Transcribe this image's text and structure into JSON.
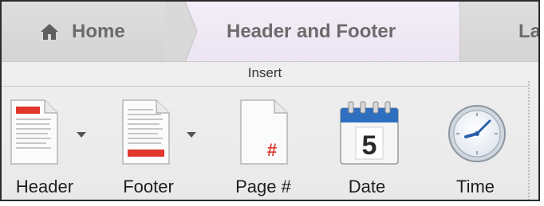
{
  "tabs": [
    {
      "label": "Home",
      "icon": "home-icon"
    },
    {
      "label": "Header and Footer",
      "selected": true
    },
    {
      "label": "La"
    }
  ],
  "group": {
    "label": "Insert"
  },
  "buttons": [
    {
      "label": "Header",
      "icon": "header-document-icon",
      "has_dropdown": true
    },
    {
      "label": "Footer",
      "icon": "footer-document-icon",
      "has_dropdown": true
    },
    {
      "label": "Page #",
      "icon": "page-number-icon",
      "glyph": "#"
    },
    {
      "label": "Date",
      "icon": "calendar-icon",
      "glyph": "5"
    },
    {
      "label": "Time",
      "icon": "clock-icon"
    }
  ],
  "colors": {
    "accent_red": "#e0362c",
    "selected_tab": "#ece4f2",
    "calendar_blue": "#2f6fc0"
  }
}
